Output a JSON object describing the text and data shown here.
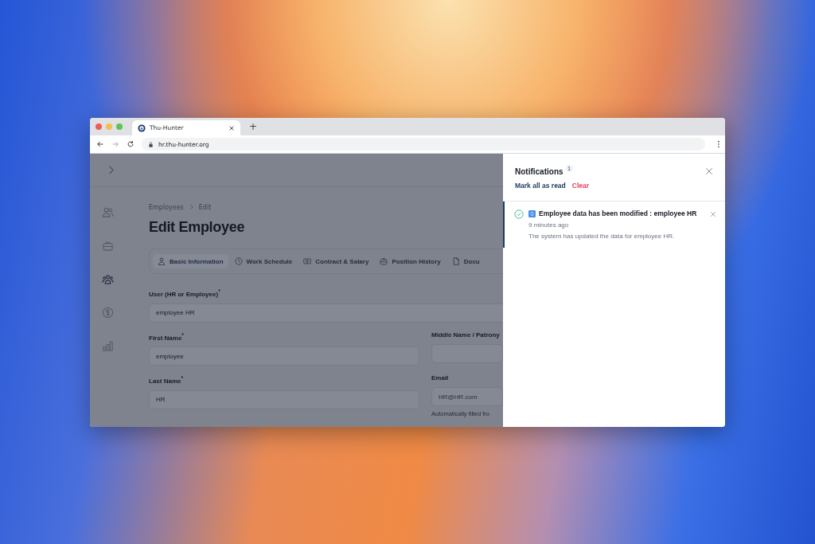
{
  "browser": {
    "tab": {
      "title": "Thu-Hunter",
      "selected": true
    },
    "new_tab": "+",
    "address": "hr.thu-hunter.org"
  },
  "app": {
    "sidebar": [
      {
        "kind": "users",
        "selected": false
      },
      {
        "kind": "briefcase",
        "selected": false
      },
      {
        "kind": "group",
        "selected": true
      },
      {
        "kind": "dollar",
        "selected": false
      },
      {
        "kind": "chart",
        "selected": false
      }
    ],
    "breadcrumb": [
      "Employees",
      "Edit"
    ],
    "title": "Edit Employee",
    "tabs": [
      {
        "label": "Basic Information",
        "kind": "person",
        "selected": true
      },
      {
        "label": "Work Schedule",
        "kind": "clock",
        "selected": false
      },
      {
        "label": "Contract & Salary",
        "kind": "money",
        "selected": false
      },
      {
        "label": "Position History",
        "kind": "briefcase",
        "selected": false
      },
      {
        "label": "Docu",
        "kind": "document",
        "selected": false
      }
    ],
    "fields": [
      {
        "label": "User (HR or Employee)$^{*}$",
        "value": "employee HR",
        "full_width": true
      },
      {
        "label": "First Name$^{*}$",
        "value": "employee",
        "full_width": false
      },
      {
        "label": "Middle Name / Patrony",
        "full_width": false
      },
      {
        "label": "Last Name$^{*}$",
        "value": "HR",
        "full_width": false
      },
      {
        "label": "Email",
        "placeholder": "HR@HR.com",
        "helper": "Automatically filled fro",
        "full_width": false
      }
    ]
  },
  "notifications": {
    "title": "Notifications",
    "count": "1",
    "mark_all": "Mark all as read",
    "clear": "Clear",
    "items": [
      {
        "title": "Employee data has been modified : employee HR",
        "time": "9 minutes ago",
        "body": "The system has updated the data for employee HR.",
        "read": false
      }
    ]
  }
}
